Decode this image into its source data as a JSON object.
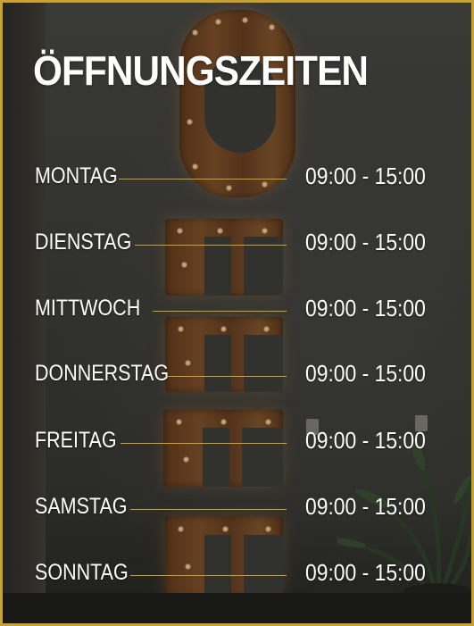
{
  "title": "ÖFFNUNGSZEITEN",
  "accent_color": "#c9a233",
  "schedule": [
    {
      "day": "MONTAG",
      "hours": "09:00 - 15:00"
    },
    {
      "day": "DIENSTAG",
      "hours": "09:00 - 15:00"
    },
    {
      "day": "MITTWOCH",
      "hours": "09:00 - 15:00"
    },
    {
      "day": "DONNERSTAG",
      "hours": "09:00 - 15:00"
    },
    {
      "day": "FREITAG",
      "hours": "09:00 - 15:00"
    },
    {
      "day": "SAMSTAG",
      "hours": "09:00 - 15:00"
    },
    {
      "day": "SONNTAG",
      "hours": "09:00 - 15:00"
    }
  ]
}
